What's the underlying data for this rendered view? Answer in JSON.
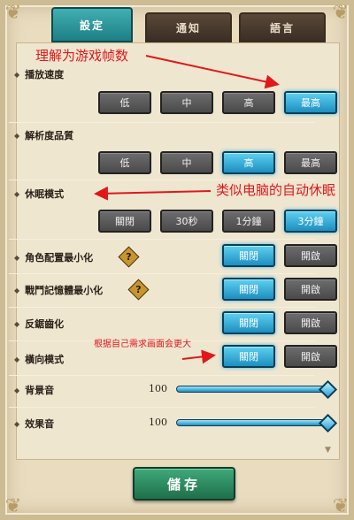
{
  "tabs": [
    {
      "label": "設定",
      "active": true
    },
    {
      "label": "通知",
      "active": false
    },
    {
      "label": "語言",
      "active": false
    }
  ],
  "settings": {
    "playback_speed": {
      "label": "播放速度",
      "options": [
        "低",
        "中",
        "高",
        "最高"
      ],
      "selected": "最高"
    },
    "resolution": {
      "label": "解析度品質",
      "options": [
        "低",
        "中",
        "高",
        "最高"
      ],
      "selected": "高"
    },
    "sleep_mode": {
      "label": "休眠模式",
      "options": [
        "關閉",
        "30秒",
        "1分鐘",
        "3分鐘"
      ],
      "selected": "3分鐘"
    },
    "character_minimize": {
      "label": "角色配置最小化",
      "help": "?",
      "options": [
        "關閉",
        "開啟"
      ],
      "selected": "關閉"
    },
    "battle_memory_minimize": {
      "label": "戰鬥記憶體最小化",
      "help": "?",
      "options": [
        "關閉",
        "開啟"
      ],
      "selected": "關閉"
    },
    "anti_aliasing": {
      "label": "反鋸齒化",
      "options": [
        "關閉",
        "開啟"
      ],
      "selected": "關閉"
    },
    "landscape_mode": {
      "label": "橫向模式",
      "options": [
        "關閉",
        "開啟"
      ],
      "selected": "關閉"
    },
    "bgm": {
      "label": "背景音",
      "value": "100"
    },
    "sfx": {
      "label": "效果音",
      "value": "100"
    }
  },
  "save_label": "儲存",
  "annotations": {
    "frame_rate": "理解为游戏帧数",
    "auto_sleep": "类似电脑的自动休眠",
    "landscape": "根据自己需求画面会更大"
  },
  "colors": {
    "selected_button": "#2aa8de",
    "unselected_button": "#555555",
    "active_tab": "#2a9aa0",
    "save_button": "#2f8a5f",
    "annotation": "#e0181b"
  }
}
